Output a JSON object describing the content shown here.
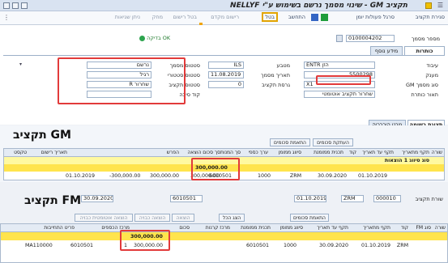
{
  "window": {
    "title": "תקציב GM - שינוי מסמך נרשם בשימוש ע\"י NELLYF"
  },
  "toolbar": {
    "items": [
      "סגירת תקציב",
      "סרגל פעולות יומן",
      "התחשב",
      "בטל",
      "רישום מקדם",
      "בטל רישום",
      "מחק",
      "ניתן שגיאות"
    ]
  },
  "header": {
    "doc_number_label": "מספר מסמך",
    "doc_number_value": "0100004202",
    "check_ok": "בדיקה OK"
  },
  "tabs_top": {
    "content": "כותרות",
    "info": "מידע נוסף"
  },
  "form": {
    "process_label": "עיבוד",
    "process_value": "ENTR הזן",
    "budget_label": "מענק",
    "budget_value": "5500298",
    "type_label": "סוג מסמך GM",
    "type_value": "X1",
    "desc_label": "תאור כותרת",
    "desc_value": "שחרור תקציב אוטומטי",
    "currency_label": "מטבע",
    "currency_value": "ILS",
    "date_label": "תאריך מסמך",
    "date_value": "11.08.2019",
    "version_label": "גרסת תקציב",
    "version_value": "0",
    "doc_status_label": "סטטוס מסמך",
    "doc_status_value": "נרשם",
    "wf_status_label": "סטטוס סטטורי",
    "wf_status_value": "רגיל",
    "budget_status_label": "סטטוס תקציב",
    "budget_status_value": "R שחרור",
    "reason_label": "קוד סיבה",
    "reason_value": ""
  },
  "tabs_mid": {
    "entry": "תצוגת רשומה",
    "hier": "מבט היררכיה"
  },
  "gm": {
    "heading": "תקציב GM",
    "buttons": [
      "התאמת סכומים",
      "העתקת סכומים"
    ],
    "columns": [
      "שורה",
      "תקף מתאריך",
      "תקף עד תאריך",
      "קוד",
      "תכנית ממומנת",
      "סיווג ממומן",
      "ערך כספי",
      "סך המנות",
      "סך סכום הוצאה",
      "הפרש",
      "תאריך רישום",
      "טקסט"
    ],
    "row_title": "סוג סיווג 1 הוצאות",
    "row": {
      "from": "01.10.2019",
      "to": "30.09.2020",
      "code": "ZRM",
      "fp": "6010501",
      "cls": "1000",
      "amount": "300,000.00",
      "total": "300,000.00",
      "diff": "-300,000.00",
      "date": "01.10.2019"
    },
    "total_value": "300,000.00"
  },
  "fm": {
    "heading": "תקציב FM",
    "line_label": "שורת תקציב",
    "line_value": "000010",
    "code_value": "ZRM",
    "period_from": "01.10.2019",
    "period_to": "30.09.2020",
    "fp_value": "6010501",
    "buttons": [
      "הוצאה אוטומטית כבויה",
      "הוצאה כבויה",
      "הוצאה",
      "הצג הכל",
      "התאמת סכומים"
    ],
    "columns": [
      "שורה",
      "סוג FM",
      "קוד",
      "תקף מתאריך",
      "תקף עד תאריך",
      "סיווג ממומן",
      "תכנית ממומנת",
      "מרכז קרנות",
      "סכום",
      "מרכז הכספים",
      "פריט התחייבות"
    ],
    "row": {
      "from": "01.10.2019",
      "to": "30.09.2020",
      "code": "ZRM",
      "cls": "1000",
      "fp": "6010501",
      "amount": "300,000.00",
      "line": "1",
      "fund": "MA110000"
    },
    "total_value": "300,000.00"
  }
}
